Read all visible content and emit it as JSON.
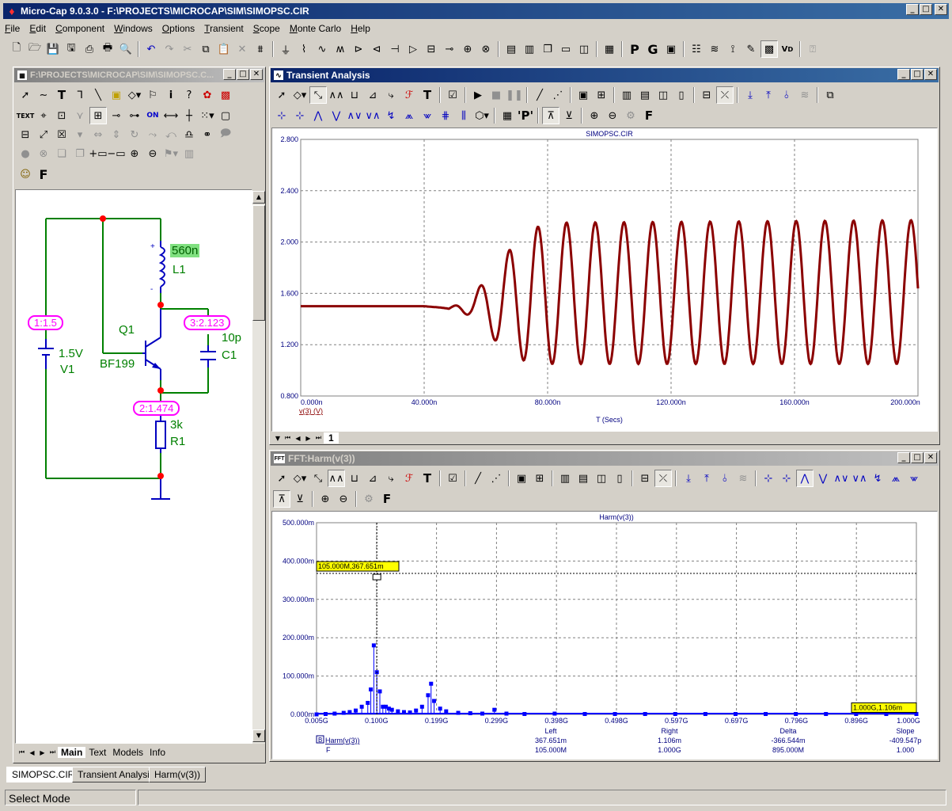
{
  "app": {
    "title": "Micro-Cap 9.0.3.0 - F:\\PROJECTS\\MICROCAP\\SIM\\SIMOPSC.CIR",
    "status": "Select Mode"
  },
  "menu": [
    "File",
    "Edit",
    "Component",
    "Windows",
    "Options",
    "Transient",
    "Scope",
    "Monte Carlo",
    "Help"
  ],
  "schematic_window": {
    "title": "F:\\PROJECTS\\MICROCAP\\SIM\\SIMOPSC.C...",
    "tabs": [
      "Main",
      "Text",
      "Models",
      "Info"
    ],
    "components": {
      "inductor_value": "560n",
      "inductor_name": "L1",
      "transistor_name": "Q1",
      "transistor_model": "BF199",
      "cap_value": "10p",
      "cap_name": "C1",
      "res_value": "3k",
      "res_name": "R1",
      "source_value": "1.5V",
      "source_name": "V1",
      "node1": "1:1.5",
      "node2": "2:1.474",
      "node3": "3:2.123"
    },
    "mini_labels": {
      "text_btn": "TEXT",
      "f_btn": "F"
    }
  },
  "transient_window": {
    "title": "Transient Analysis",
    "tab": "1",
    "colors": {
      "trace": "#8b0000",
      "axis_text": "#000080"
    }
  },
  "fft_window": {
    "title": "FFT:Harm(v(3))",
    "cursor_label": "105.000M,367.651m",
    "cursor_label_right": "1.000G,1.106m",
    "table": {
      "headers": [
        "Left",
        "Right",
        "Delta",
        "Slope"
      ],
      "rows": [
        {
          "name": "Harm(v(3))",
          "values": [
            "367.651m",
            "1.106m",
            "-366.544m",
            "-409.547p"
          ]
        },
        {
          "name": "F",
          "values": [
            "105.000M",
            "1.000G",
            "895.000M",
            "1.000"
          ]
        }
      ]
    }
  },
  "bottom_tabs": [
    "SIMOPSC.CIR",
    "Transient Analysis",
    "Harm(v(3))"
  ],
  "chart_data": [
    {
      "type": "line",
      "title": "SIMOPSC.CIR",
      "xlabel": "T (Secs)",
      "ylabel": "",
      "series": [
        {
          "name": "v(3) (V)",
          "color": "#8b0000"
        }
      ],
      "x_ticks": [
        "0.000n",
        "40.000n",
        "80.000n",
        "120.000n",
        "160.000n",
        "200.000n"
      ],
      "y_ticks": [
        "0.800",
        "1.200",
        "1.600",
        "2.000",
        "2.400",
        "2.800"
      ],
      "xlim": [
        0,
        200
      ],
      "ylim": [
        0.8,
        2.8
      ],
      "grid": true,
      "envelope": {
        "baseline": 1.5,
        "period_ns": 9.3,
        "samples": [
          [
            0,
            1.5
          ],
          [
            30,
            1.5
          ],
          [
            40,
            1.5
          ],
          [
            48,
            1.48
          ],
          [
            55,
            1.58
          ],
          [
            62,
            1.75
          ],
          [
            68,
            1.95
          ],
          [
            75,
            2.1
          ],
          [
            80,
            2.15
          ],
          [
            200,
            2.17
          ]
        ],
        "min_samples": [
          [
            0,
            1.5
          ],
          [
            40,
            1.5
          ],
          [
            50,
            1.48
          ],
          [
            55,
            1.42
          ],
          [
            60,
            1.3
          ],
          [
            68,
            1.12
          ],
          [
            75,
            1.05
          ],
          [
            200,
            1.05
          ]
        ]
      }
    },
    {
      "type": "bar",
      "title": "Harm(v(3))",
      "xlabel": "",
      "ylabel": "",
      "x_ticks": [
        "0.005G",
        "0.100G",
        "0.199G",
        "0.299G",
        "0.398G",
        "0.498G",
        "0.597G",
        "0.697G",
        "0.796G",
        "0.896G",
        "1.000G"
      ],
      "y_ticks": [
        "0.000m",
        "100.000m",
        "200.000m",
        "300.000m",
        "400.000m",
        "500.000m"
      ],
      "xlim": [
        0.005,
        1.0
      ],
      "ylim": [
        0,
        500
      ],
      "grid": true,
      "color": "#0000ff",
      "points": [
        [
          0.005,
          0
        ],
        [
          0.02,
          1
        ],
        [
          0.035,
          2
        ],
        [
          0.05,
          4
        ],
        [
          0.06,
          6
        ],
        [
          0.07,
          10
        ],
        [
          0.08,
          20
        ],
        [
          0.09,
          30
        ],
        [
          0.095,
          65
        ],
        [
          0.1,
          180
        ],
        [
          0.105,
          110
        ],
        [
          0.11,
          60
        ],
        [
          0.115,
          20
        ],
        [
          0.12,
          20
        ],
        [
          0.125,
          15
        ],
        [
          0.13,
          12
        ],
        [
          0.14,
          8
        ],
        [
          0.15,
          6
        ],
        [
          0.16,
          5
        ],
        [
          0.17,
          10
        ],
        [
          0.18,
          20
        ],
        [
          0.19,
          50
        ],
        [
          0.195,
          80
        ],
        [
          0.2,
          35
        ],
        [
          0.21,
          15
        ],
        [
          0.22,
          8
        ],
        [
          0.24,
          4
        ],
        [
          0.26,
          3
        ],
        [
          0.28,
          2
        ],
        [
          0.3,
          12
        ],
        [
          0.32,
          2
        ],
        [
          0.35,
          1
        ],
        [
          0.4,
          2
        ],
        [
          0.45,
          1
        ],
        [
          0.5,
          1
        ],
        [
          0.55,
          1
        ],
        [
          0.6,
          1
        ],
        [
          0.65,
          1
        ],
        [
          0.7,
          1
        ],
        [
          0.75,
          1
        ],
        [
          0.8,
          1
        ],
        [
          0.85,
          1
        ],
        [
          0.9,
          1
        ],
        [
          0.95,
          1
        ],
        [
          1.0,
          1
        ]
      ]
    }
  ]
}
